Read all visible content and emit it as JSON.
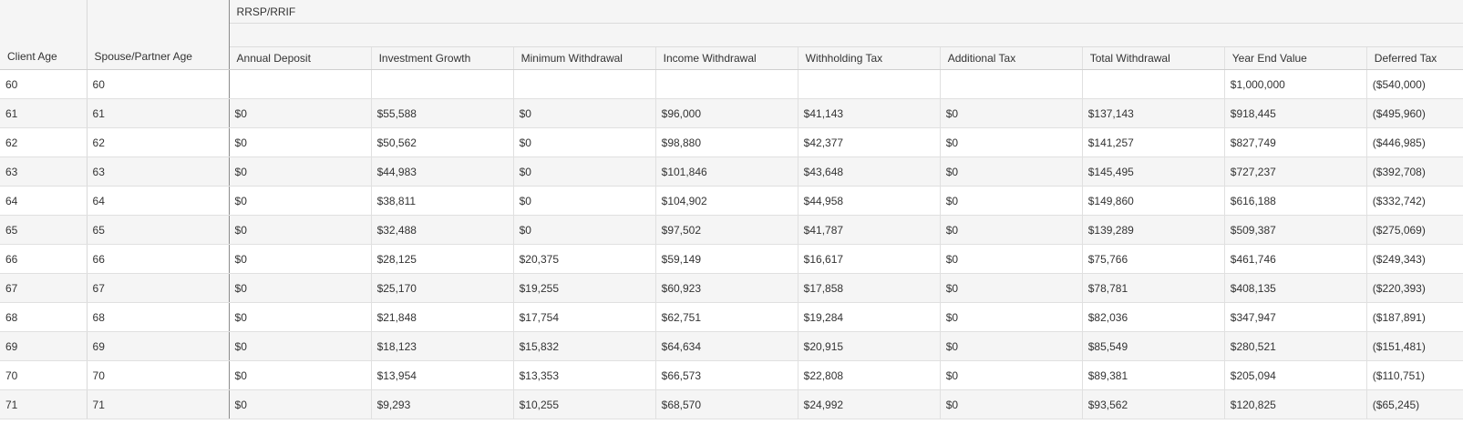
{
  "table": {
    "group_label": "RRSP/RRIF",
    "fixed_headers": {
      "client_age": "Client Age",
      "spouse_age": "Spouse/Partner Age"
    },
    "columns": [
      "Annual Deposit",
      "Investment Growth",
      "Minimum Withdrawal",
      "Income Withdrawal",
      "Withholding Tax",
      "Additional Tax",
      "Total Withdrawal",
      "Year End Value",
      "Deferred Tax"
    ],
    "rows": [
      {
        "client_age": "60",
        "spouse_age": "60",
        "values": [
          "",
          "",
          "",
          "",
          "",
          "",
          "",
          "$1,000,000",
          "($540,000)"
        ]
      },
      {
        "client_age": "61",
        "spouse_age": "61",
        "values": [
          "$0",
          "$55,588",
          "$0",
          "$96,000",
          "$41,143",
          "$0",
          "$137,143",
          "$918,445",
          "($495,960)"
        ]
      },
      {
        "client_age": "62",
        "spouse_age": "62",
        "values": [
          "$0",
          "$50,562",
          "$0",
          "$98,880",
          "$42,377",
          "$0",
          "$141,257",
          "$827,749",
          "($446,985)"
        ]
      },
      {
        "client_age": "63",
        "spouse_age": "63",
        "values": [
          "$0",
          "$44,983",
          "$0",
          "$101,846",
          "$43,648",
          "$0",
          "$145,495",
          "$727,237",
          "($392,708)"
        ]
      },
      {
        "client_age": "64",
        "spouse_age": "64",
        "values": [
          "$0",
          "$38,811",
          "$0",
          "$104,902",
          "$44,958",
          "$0",
          "$149,860",
          "$616,188",
          "($332,742)"
        ]
      },
      {
        "client_age": "65",
        "spouse_age": "65",
        "values": [
          "$0",
          "$32,488",
          "$0",
          "$97,502",
          "$41,787",
          "$0",
          "$139,289",
          "$509,387",
          "($275,069)"
        ]
      },
      {
        "client_age": "66",
        "spouse_age": "66",
        "values": [
          "$0",
          "$28,125",
          "$20,375",
          "$59,149",
          "$16,617",
          "$0",
          "$75,766",
          "$461,746",
          "($249,343)"
        ]
      },
      {
        "client_age": "67",
        "spouse_age": "67",
        "values": [
          "$0",
          "$25,170",
          "$19,255",
          "$60,923",
          "$17,858",
          "$0",
          "$78,781",
          "$408,135",
          "($220,393)"
        ]
      },
      {
        "client_age": "68",
        "spouse_age": "68",
        "values": [
          "$0",
          "$21,848",
          "$17,754",
          "$62,751",
          "$19,284",
          "$0",
          "$82,036",
          "$347,947",
          "($187,891)"
        ]
      },
      {
        "client_age": "69",
        "spouse_age": "69",
        "values": [
          "$0",
          "$18,123",
          "$15,832",
          "$64,634",
          "$20,915",
          "$0",
          "$85,549",
          "$280,521",
          "($151,481)"
        ]
      },
      {
        "client_age": "70",
        "spouse_age": "70",
        "values": [
          "$0",
          "$13,954",
          "$13,353",
          "$66,573",
          "$22,808",
          "$0",
          "$89,381",
          "$205,094",
          "($110,751)"
        ]
      },
      {
        "client_age": "71",
        "spouse_age": "71",
        "values": [
          "$0",
          "$9,293",
          "$10,255",
          "$68,570",
          "$24,992",
          "$0",
          "$93,562",
          "$120,825",
          "($65,245)"
        ]
      }
    ]
  }
}
